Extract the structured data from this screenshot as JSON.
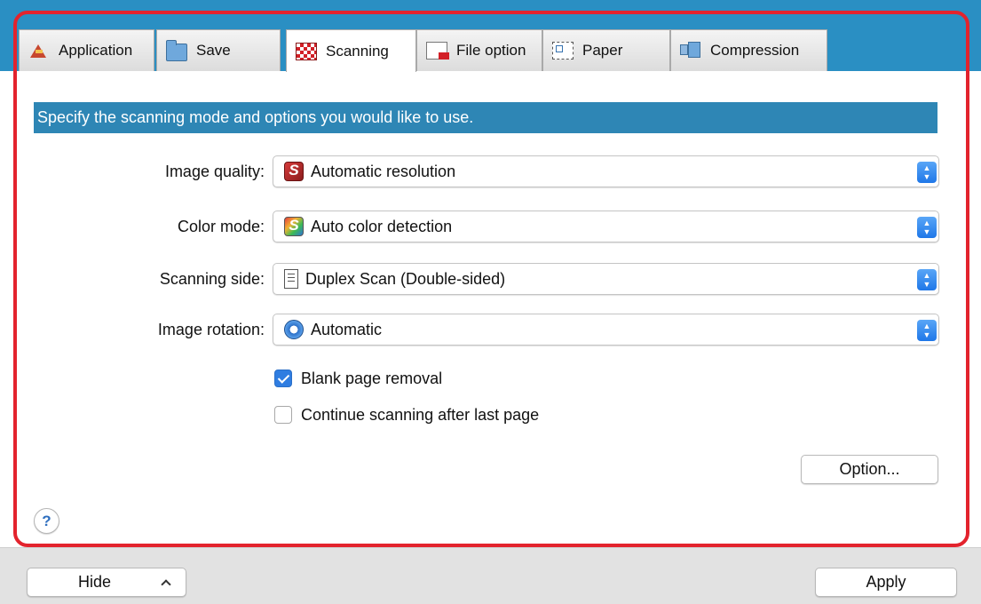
{
  "tabs": [
    {
      "label": "Application",
      "icon": "application-icon"
    },
    {
      "label": "Save",
      "icon": "folder-icon"
    },
    {
      "label": "Scanning",
      "icon": "scanning-icon",
      "active": true
    },
    {
      "label": "File option",
      "icon": "file-option-icon"
    },
    {
      "label": "Paper",
      "icon": "paper-icon"
    },
    {
      "label": "Compression",
      "icon": "compression-icon"
    }
  ],
  "banner": "Specify the scanning mode and options you would like to use.",
  "fields": {
    "image_quality": {
      "label": "Image quality:",
      "value": "Automatic resolution",
      "icon": "scansnap-red-icon"
    },
    "color_mode": {
      "label": "Color mode:",
      "value": "Auto color detection",
      "icon": "scansnap-color-icon"
    },
    "scanning_side": {
      "label": "Scanning side:",
      "value": "Duplex Scan (Double-sided)",
      "icon": "duplex-page-icon"
    },
    "image_rotation": {
      "label": "Image rotation:",
      "value": "Automatic",
      "icon": "rotate-icon"
    }
  },
  "checkboxes": {
    "blank_page_removal": {
      "label": "Blank page removal",
      "checked": true
    },
    "continue_scanning": {
      "label": "Continue scanning after last page",
      "checked": false
    }
  },
  "buttons": {
    "option": "Option...",
    "help": "?",
    "hide": "Hide",
    "apply": "Apply"
  },
  "colors": {
    "highlight_border": "#e3232d",
    "banner_bg": "#2e86b5",
    "top_strip": "#2a8fc3",
    "checkbox_accent": "#2f7de1"
  }
}
